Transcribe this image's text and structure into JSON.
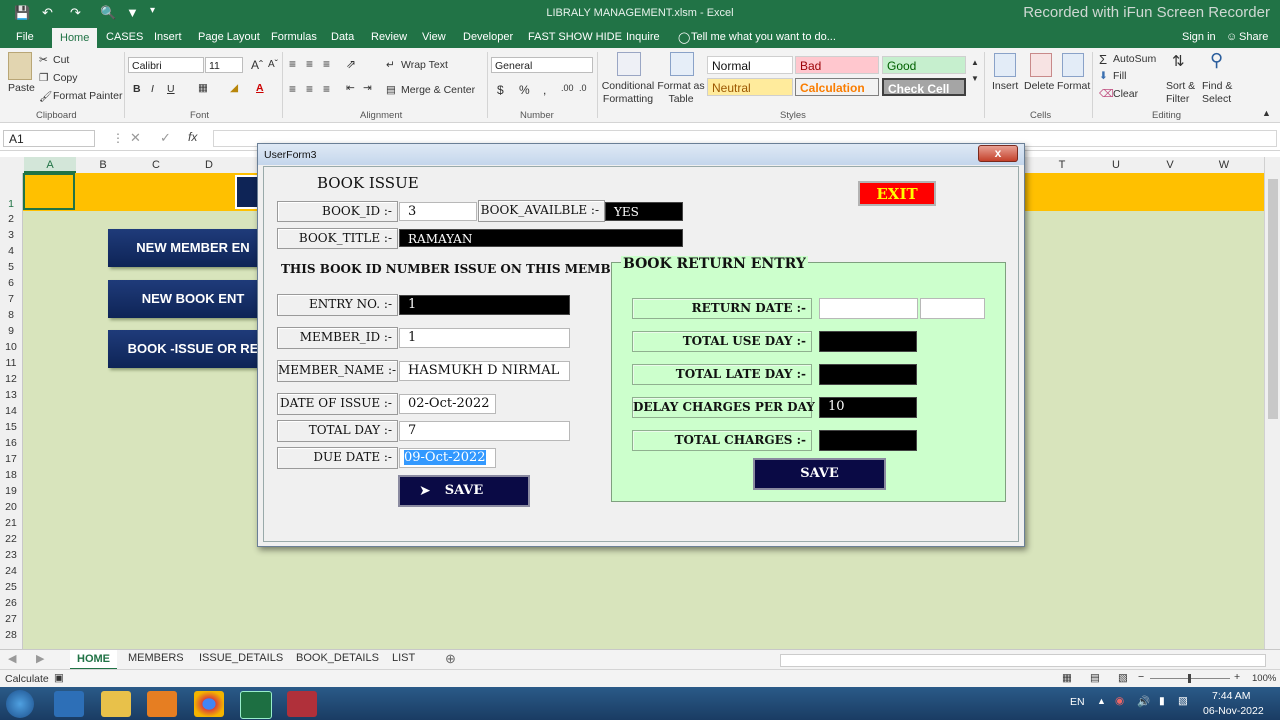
{
  "window": {
    "doc_title": "LIBRALY MANAGEMENT.xlsm - Excel",
    "recorder_watermark": "Recorded with iFun Screen Recorder"
  },
  "ribbon_tabs": [
    "File",
    "Home",
    "CASES",
    "Insert",
    "Page Layout",
    "Formulas",
    "Data",
    "Review",
    "View",
    "Developer",
    "FAST SHOW HIDE",
    "Inquire"
  ],
  "ribbon_tell_me": "Tell me what you want to do...",
  "ribbon_right": {
    "signin": "Sign in",
    "share": "Share"
  },
  "clipboard": {
    "paste": "Paste",
    "cut": "Cut",
    "copy": "Copy",
    "format_painter": "Format Painter",
    "group": "Clipboard"
  },
  "font": {
    "name": "Calibri",
    "size": "11",
    "group": "Font"
  },
  "alignment": {
    "wrap_text": "Wrap Text",
    "merge_center": "Merge & Center",
    "group": "Alignment"
  },
  "number": {
    "format": "General",
    "group": "Number"
  },
  "styles": {
    "conditional_formatting": "Conditional Formatting",
    "format_as_table": "Format as Table",
    "normal": "Normal",
    "bad": "Bad",
    "good": "Good",
    "neutral": "Neutral",
    "calculation": "Calculation",
    "check_cell": "Check Cell",
    "group": "Styles"
  },
  "cells_group": {
    "insert": "Insert",
    "delete": "Delete",
    "format": "Format",
    "group": "Cells"
  },
  "editing": {
    "autosum": "AutoSum",
    "fill": "Fill",
    "clear": "Clear",
    "sort_filter": "Sort & Filter",
    "find_select": "Find & Select",
    "group": "Editing"
  },
  "formula_bar": {
    "name_box": "A1",
    "formula": ""
  },
  "columns": [
    "A",
    "B",
    "C",
    "D",
    "T",
    "U",
    "V",
    "W"
  ],
  "rows": [
    "1",
    "2",
    "3",
    "4",
    "5",
    "6",
    "7",
    "8",
    "9",
    "10",
    "11",
    "12",
    "13",
    "14",
    "15",
    "16",
    "17",
    "18",
    "19",
    "20",
    "21",
    "22",
    "23",
    "24",
    "25",
    "26",
    "27",
    "28"
  ],
  "sheet_buttons": [
    "NEW MEMBER EN",
    "NEW BOOK ENT",
    "BOOK -ISSUE  OR  RE"
  ],
  "sheet_tabs": [
    "HOME",
    "MEMBERS",
    "ISSUE_DETAILS",
    "BOOK_DETAILS",
    "LIST"
  ],
  "status": {
    "mode": "Calculate",
    "zoom": "100%"
  },
  "taskbar": {
    "lang": "EN",
    "time": "7:44 AM",
    "date": "06-Nov-2022"
  },
  "userform": {
    "title": "UserForm3",
    "close_glyph": "x",
    "heading": "BOOK ISSUE",
    "exit_label": "EXIT",
    "book_id_label": "BOOK_ID :-",
    "book_id_value": "3",
    "book_available_label": "BOOK_AVAILBLE  :-",
    "book_available_value": "YES",
    "book_title_label": "BOOK_TITLE :-",
    "book_title_value": "RAMAYAN",
    "issue_note": "THIS BOOK ID NUMBER ISSUE ON THIS MEMBER",
    "entry_no_label": "ENTRY NO. :-",
    "entry_no_value": "1",
    "member_id_label": "MEMBER_ID :-",
    "member_id_value": "1",
    "member_name_label": "MEMBER_NAME :-",
    "member_name_value": "HASMUKH D NIRMAL",
    "date_of_issue_label": "DATE OF ISSUE :-",
    "date_of_issue_value": "02-Oct-2022",
    "total_day_label": "TOTAL DAY :-",
    "total_day_value": "7",
    "due_date_label": "DUE DATE :-",
    "due_date_value": "09-Oct-2022",
    "save_label": "SAVE",
    "return": {
      "frame_title": "BOOK RETURN ENTRY",
      "return_date_label": "RETURN DATE :-",
      "return_date_value": "",
      "total_use_day_label": "TOTAL USE DAY :-",
      "total_use_day_value": "",
      "total_late_day_label": "TOTAL LATE DAY :-",
      "total_late_day_value": "",
      "delay_charges_label": "DELAY CHARGES PER DAY :-",
      "delay_charges_value": "10",
      "total_charges_label": "TOTAL CHARGES :-",
      "total_charges_value": "",
      "save_label": "SAVE"
    }
  }
}
